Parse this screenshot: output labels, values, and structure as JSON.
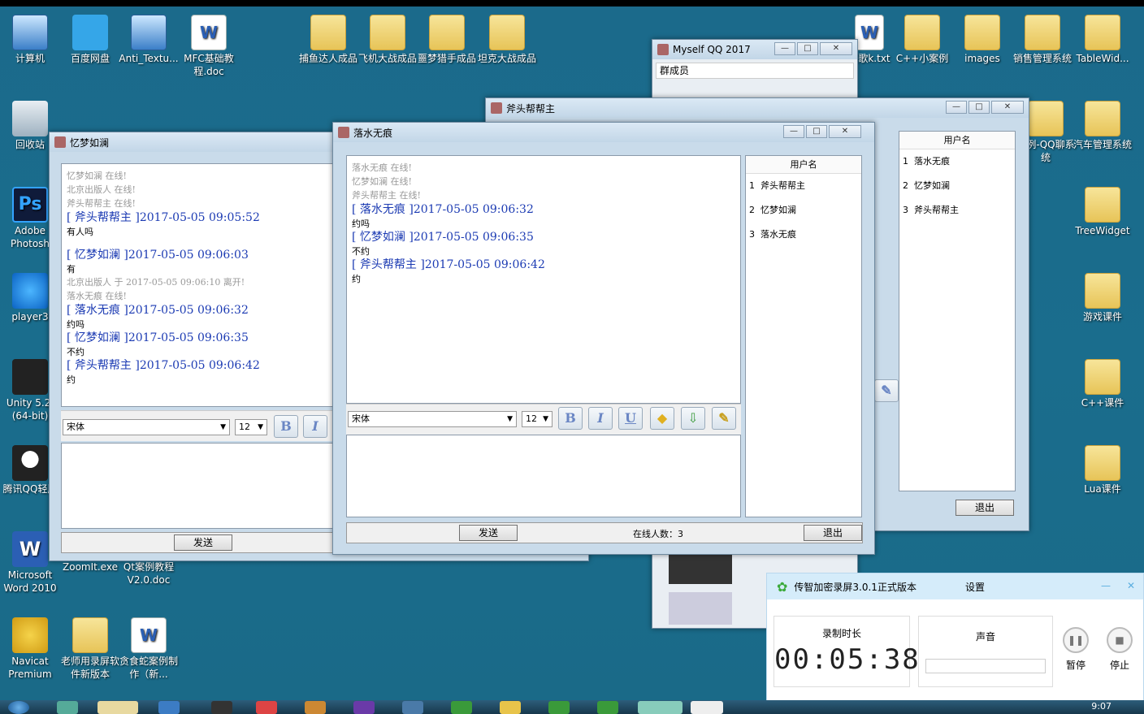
{
  "desktop_icons": [
    {
      "label": "计算机",
      "icon": "computer-icon"
    },
    {
      "label": "百度网盘",
      "icon": "baidu-cloud-icon"
    },
    {
      "label": "Anti_Textu...",
      "icon": "app-icon"
    },
    {
      "label": "MFC基础教程.doc",
      "icon": "word-doc-icon"
    },
    {
      "label": "捕鱼达人成品",
      "icon": "folder-icon"
    },
    {
      "label": "飞机大战成品",
      "icon": "folder-icon"
    },
    {
      "label": "噩梦猎手成品",
      "icon": "folder-icon"
    },
    {
      "label": "坦克大战成品",
      "icon": "folder-icon"
    },
    {
      "label": "回收站",
      "icon": "recycle-bin-icon"
    },
    {
      "label": "Adobe Photosh",
      "icon": "photoshop-icon"
    },
    {
      "label": "player3",
      "icon": "player-icon"
    },
    {
      "label": "Unity 5.2. (64-bit)",
      "icon": "unity-icon"
    },
    {
      "label": "腾讯QQ轻版",
      "icon": "qq-icon"
    },
    {
      "label": "Microsoft Word 2010",
      "icon": "word-icon"
    },
    {
      "label": "ZoomIt.exe",
      "icon": "zoomit-icon"
    },
    {
      "label": "Qt案例教程V2.0.doc",
      "icon": "word-doc-icon"
    },
    {
      "label": "Navicat Premium",
      "icon": "navicat-icon"
    },
    {
      "label": "老师用录屏软件新版本",
      "icon": "folder-icon"
    },
    {
      "label": "贪食蛇案例制作（新...",
      "icon": "word-doc-icon"
    },
    {
      "label": "C++小案例",
      "icon": "folder-icon"
    },
    {
      "label": "images",
      "icon": "folder-icon"
    },
    {
      "label": "销售管理系统",
      "icon": "folder-icon"
    },
    {
      "label": "TableWid...",
      "icon": "folder-icon"
    },
    {
      "label": "案例-QQ聊系统",
      "icon": "folder-icon"
    },
    {
      "label": "汽车管理系统",
      "icon": "folder-icon"
    },
    {
      "label": "TreeWidget",
      "icon": "folder-icon"
    },
    {
      "label": "游戏课件",
      "icon": "folder-icon"
    },
    {
      "label": "C++课件",
      "icon": "folder-icon"
    },
    {
      "label": "Lua课件",
      "icon": "folder-icon"
    },
    {
      "label": "报歌k.txt",
      "icon": "text-file-icon"
    }
  ],
  "qq2017": {
    "title": "Myself QQ 2017",
    "group_label": "群成员"
  },
  "win_futou": {
    "title": "斧头帮帮主",
    "user_header": "用户名",
    "users": [
      {
        "n": "1",
        "name": "落水无痕"
      },
      {
        "n": "2",
        "name": "忆梦如澜"
      },
      {
        "n": "3",
        "name": "斧头帮帮主"
      }
    ],
    "exit_label": "退出"
  },
  "win_yimeng": {
    "title": "忆梦如澜",
    "log": [
      {
        "type": "sys",
        "text": "忆梦如澜 在线!"
      },
      {
        "type": "sys",
        "text": "北京出版人 在线!"
      },
      {
        "type": "sys",
        "text": "斧头帮帮主 在线!"
      },
      {
        "type": "head",
        "text": "[ 斧头帮帮主 ]2017-05-05 09:05:52"
      },
      {
        "type": "msg",
        "text": "有人吗"
      },
      {
        "type": "gap",
        "text": ""
      },
      {
        "type": "head",
        "text": "[ 忆梦如澜 ]2017-05-05 09:06:03"
      },
      {
        "type": "msg",
        "text": "有"
      },
      {
        "type": "sys",
        "text": "北京出版人 于 2017-05-05 09:06:10 离开!"
      },
      {
        "type": "sys",
        "text": "落水无痕 在线!"
      },
      {
        "type": "head",
        "text": "[ 落水无痕 ]2017-05-05 09:06:32"
      },
      {
        "type": "msg",
        "text": "约吗"
      },
      {
        "type": "head",
        "text": "[ 忆梦如澜 ]2017-05-05 09:06:35"
      },
      {
        "type": "msg",
        "text": "不约"
      },
      {
        "type": "head",
        "text": "[ 斧头帮帮主 ]2017-05-05 09:06:42"
      },
      {
        "type": "msg",
        "text": "约"
      }
    ],
    "font_name": "宋体",
    "font_size": "12",
    "send_label": "发送"
  },
  "win_luoshui": {
    "title": "落水无痕",
    "log": [
      {
        "type": "sys",
        "text": "落水无痕 在线!"
      },
      {
        "type": "sys",
        "text": "忆梦如澜 在线!"
      },
      {
        "type": "sys",
        "text": "斧头帮帮主 在线!"
      },
      {
        "type": "head",
        "text": "[ 落水无痕 ]2017-05-05 09:06:32"
      },
      {
        "type": "msg",
        "text": "约吗"
      },
      {
        "type": "head",
        "text": "[ 忆梦如澜 ]2017-05-05 09:06:35"
      },
      {
        "type": "msg",
        "text": "不约"
      },
      {
        "type": "head",
        "text": "[ 斧头帮帮主 ]2017-05-05 09:06:42"
      },
      {
        "type": "msg",
        "text": "约"
      }
    ],
    "user_header": "用户名",
    "users": [
      {
        "n": "1",
        "name": "斧头帮帮主"
      },
      {
        "n": "2",
        "name": "忆梦如澜"
      },
      {
        "n": "3",
        "name": "落水无痕"
      }
    ],
    "font_name": "宋体",
    "font_size": "12",
    "send_label": "发送",
    "online_count": "在线人数：3",
    "exit_label": "退出"
  },
  "recorder": {
    "title": "传智加密录屏3.0.1正式版本",
    "settings_label": "设置",
    "duration_label": "录制时长",
    "duration_value": "00:05:38",
    "sound_label": "声音",
    "pause_label": "暂停",
    "stop_label": "停止"
  },
  "taskbar": {
    "clock": "9:07"
  },
  "colors": {
    "desktop": "#1a6a88",
    "chat_head": "#1c3bb3",
    "system_text": "#999999"
  }
}
